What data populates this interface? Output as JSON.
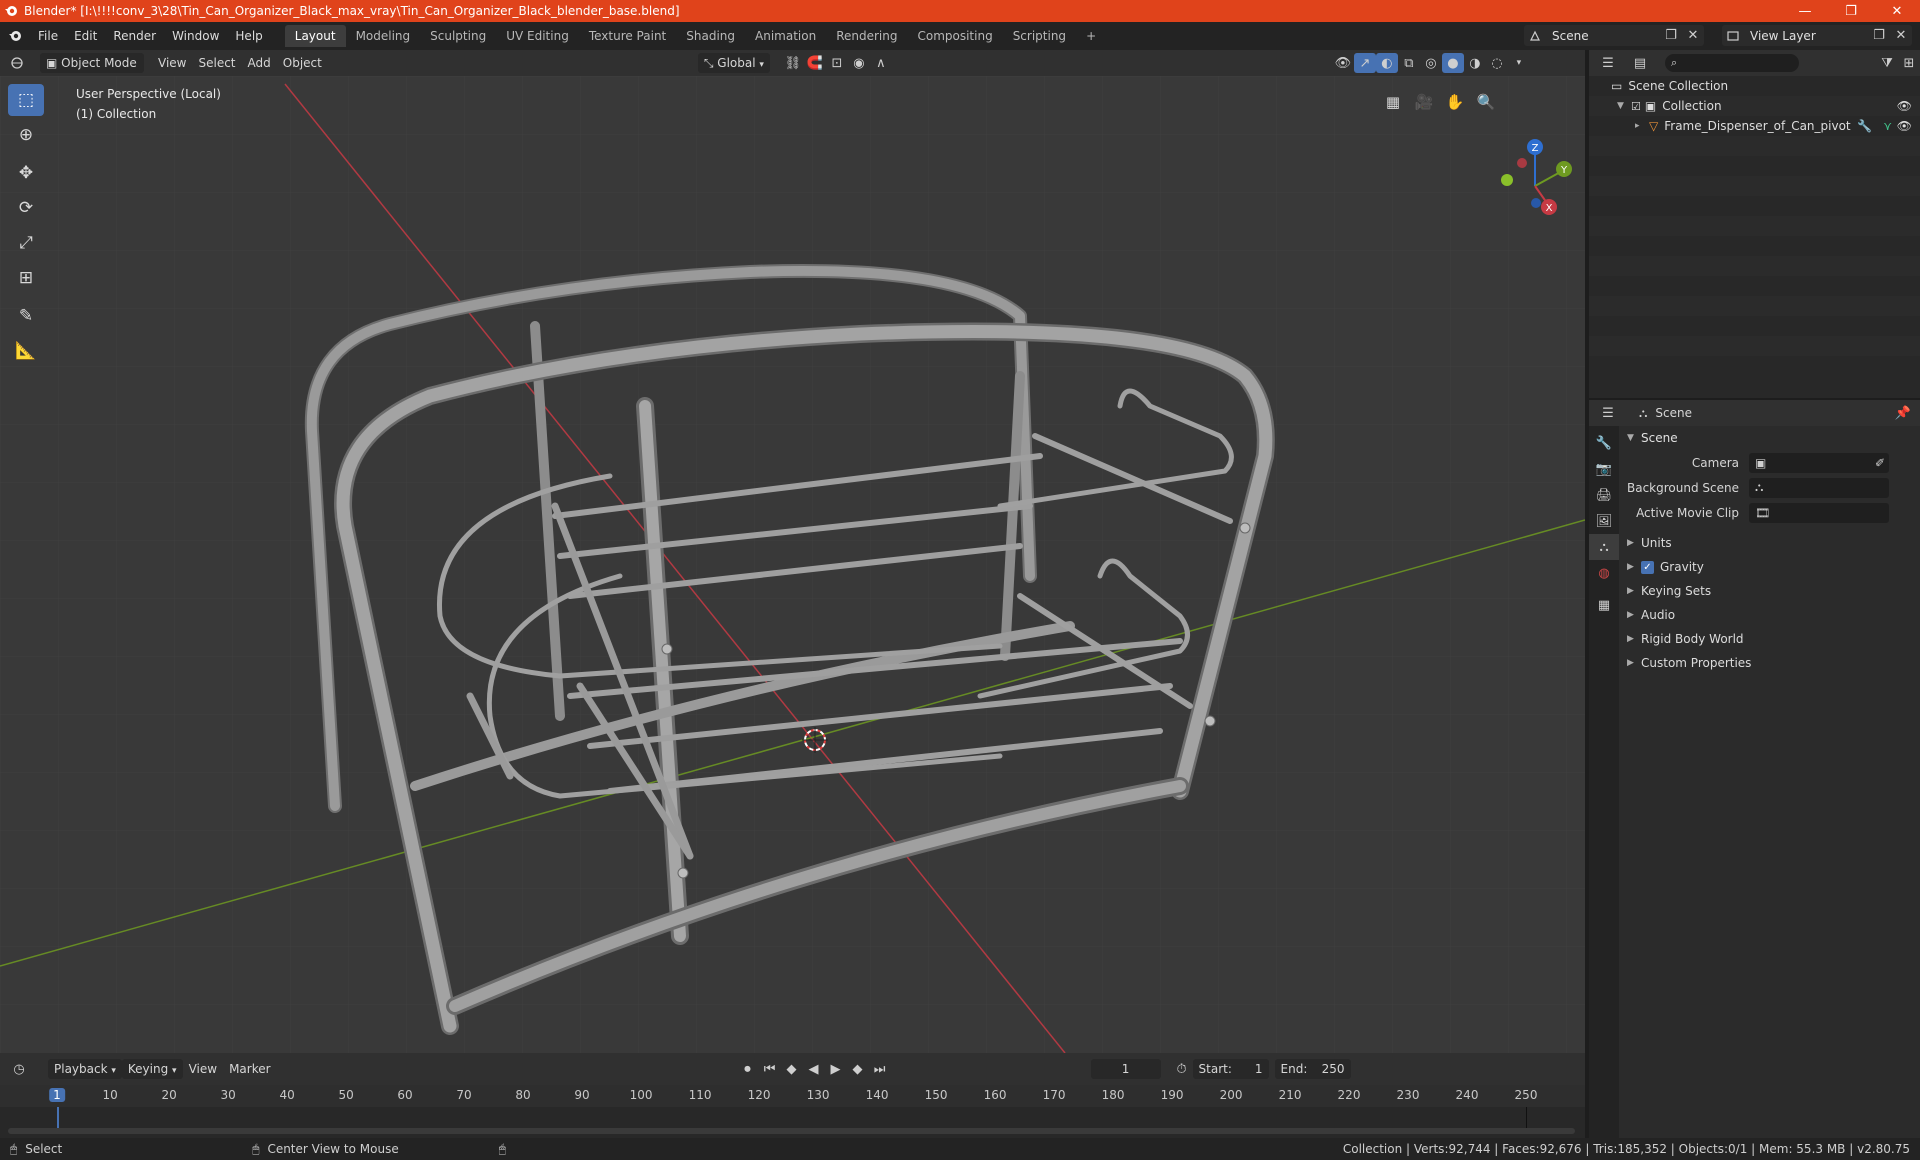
{
  "window": {
    "title": "Blender* [I:\\!!!!conv_3\\28\\Tin_Can_Organizer_Black_max_vray\\Tin_Can_Organizer_Black_blender_base.blend]",
    "minimize": "—",
    "maximize": "❐",
    "close": "✕"
  },
  "menu": [
    "File",
    "Edit",
    "Render",
    "Window",
    "Help"
  ],
  "workspaces": [
    "Layout",
    "Modeling",
    "Sculpting",
    "UV Editing",
    "Texture Paint",
    "Shading",
    "Animation",
    "Rendering",
    "Compositing",
    "Scripting"
  ],
  "active_workspace": "Layout",
  "add_workspace": "+",
  "scene_name": "Scene",
  "view_layer": "View Layer",
  "viewport": {
    "mode": "Object Mode",
    "menus": [
      "View",
      "Select",
      "Add",
      "Object"
    ],
    "transform_orientation": "Global",
    "info_line1": "User Perspective (Local)",
    "info_line2": "(1) Collection",
    "gizmo": {
      "z": "Z",
      "y": "Y",
      "x": "X"
    }
  },
  "timeline": {
    "menus": [
      "Playback",
      "Keying",
      "View",
      "Marker"
    ],
    "current_frame": "1",
    "start_label": "Start:",
    "start": "1",
    "end_label": "End:",
    "end": "250",
    "ticks": [
      "1",
      "10",
      "20",
      "30",
      "40",
      "50",
      "60",
      "70",
      "80",
      "90",
      "100",
      "110",
      "120",
      "130",
      "140",
      "150",
      "160",
      "170",
      "180",
      "190",
      "200",
      "210",
      "220",
      "230",
      "240",
      "250"
    ]
  },
  "outliner": {
    "root": "Scene Collection",
    "collection": "Collection",
    "object": "Frame_Dispenser_of_Can_pivot"
  },
  "properties": {
    "header": "Scene",
    "section": "Scene",
    "fields": [
      {
        "label": "Camera",
        "value": ""
      },
      {
        "label": "Background Scene",
        "value": ""
      },
      {
        "label": "Active Movie Clip",
        "value": ""
      }
    ],
    "panels": [
      "Units",
      "Gravity",
      "Keying Sets",
      "Audio",
      "Rigid Body World",
      "Custom Properties"
    ],
    "gravity_checked": true
  },
  "status": {
    "select": "Select",
    "center": "Center View to Mouse",
    "stats": "Collection | Verts:92,744 | Faces:92,676 | Tris:185,352 | Objects:0/1 | Mem: 55.3 MB | v2.80.75"
  },
  "colors": {
    "titlebar": "#e0431b",
    "accent": "#4772b3",
    "x_axis": "#c63a44",
    "y_axis": "#6e9a21",
    "z_axis": "#2e6fd1"
  }
}
